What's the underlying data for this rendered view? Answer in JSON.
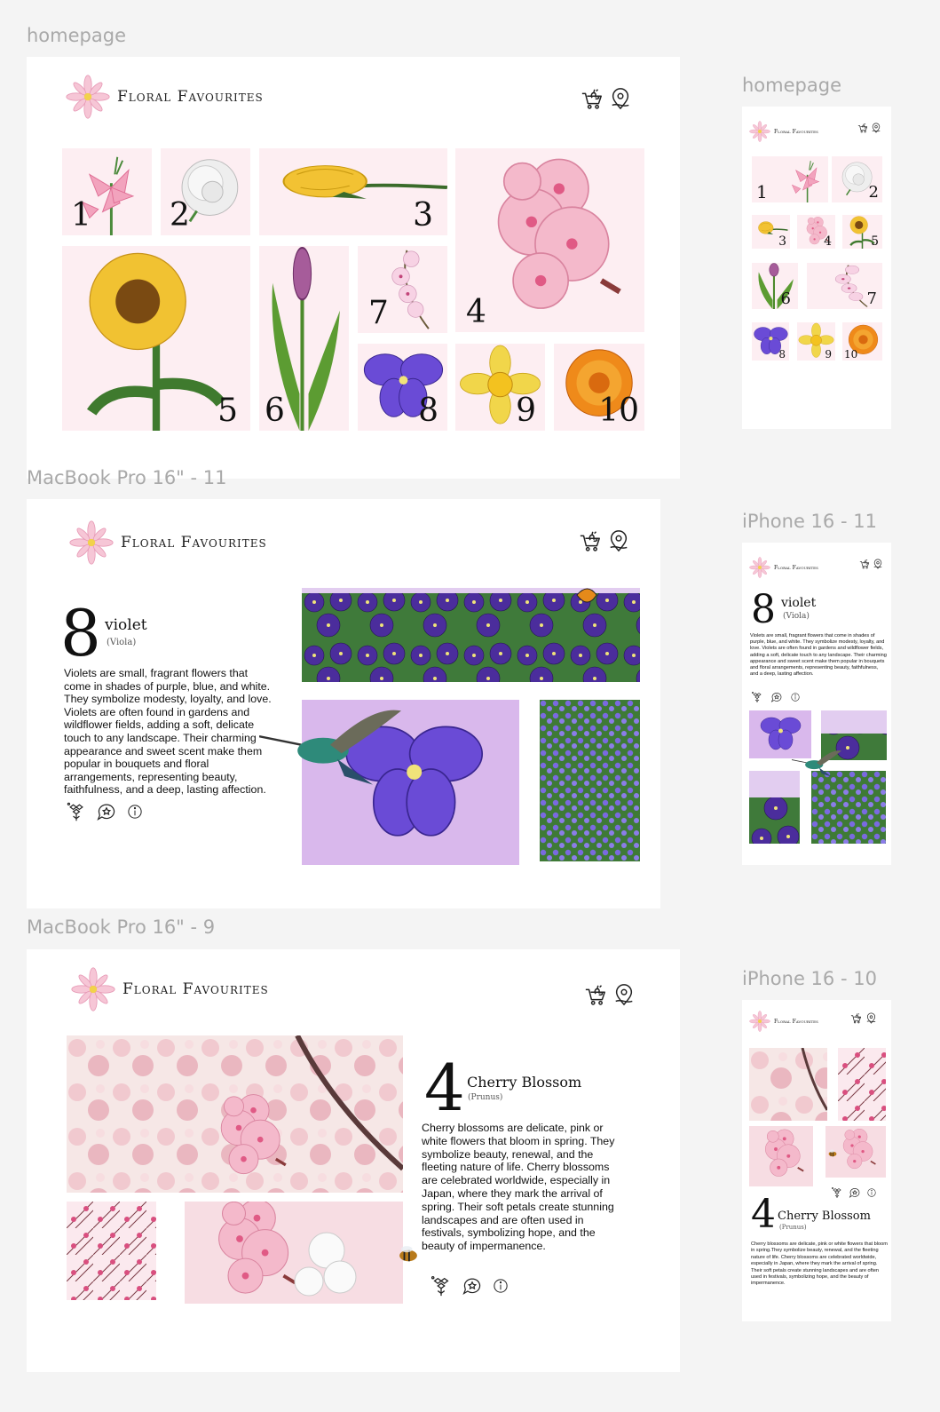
{
  "brand": {
    "name": "Floral Favourites"
  },
  "frames": {
    "homepage_desktop": {
      "label": "homepage"
    },
    "homepage_mobile": {
      "label": "homepage"
    },
    "macbook_11": {
      "label": "MacBook Pro 16\" - 11"
    },
    "iphone_11": {
      "label": "iPhone 16 - 11"
    },
    "macbook_9": {
      "label": "MacBook Pro 16\" - 9"
    },
    "iphone_10": {
      "label": "iPhone 16 - 10"
    }
  },
  "header_icons": [
    "cart-flower-icon",
    "location-pin-icon"
  ],
  "grid_tiles": [
    {
      "number": "1",
      "flower": "lily"
    },
    {
      "number": "2",
      "flower": "peony"
    },
    {
      "number": "3",
      "flower": "rose"
    },
    {
      "number": "4",
      "flower": "cherry blossom"
    },
    {
      "number": "5",
      "flower": "sunflower"
    },
    {
      "number": "6",
      "flower": "tulip"
    },
    {
      "number": "7",
      "flower": "orchid"
    },
    {
      "number": "8",
      "flower": "violet"
    },
    {
      "number": "9",
      "flower": "daffodil"
    },
    {
      "number": "10",
      "flower": "marigold"
    }
  ],
  "violet": {
    "number": "8",
    "name": "violet",
    "latin": "(Viola)",
    "description": "Violets are small, fragrant flowers that come in shades of purple, blue, and white. They symbolize modesty, loyalty, and love. Violets are often found in gardens and wildflower fields, adding a soft, delicate touch to any landscape. Their charming appearance and sweet scent make them popular in bouquets and floral arrangements, representing beauty, faithfulness, and a deep, lasting affection."
  },
  "cherry": {
    "number": "4",
    "name": "Cherry Blossom",
    "latin": "(Prunus)",
    "description": "Cherry blossoms are delicate, pink or white flowers that bloom in spring. They symbolize beauty, renewal, and the fleeting nature of life. Cherry blossoms are celebrated worldwide, especially in Japan, where they mark the arrival of spring. Their soft petals create stunning landscapes and are often used in festivals, symbolizing hope, and the beauty of impermanence.",
    "description_mobile": "Cherry blossoms are delicate, pink or white flowers that bloom in spring.They symbolize beauty, renewal, and the fleeting nature of life. Cherry blossoms are celebrated worldwide, especially in Japan, where they mark the arrival of spring. Their soft petals create stunning landscapes and are often used in festivals, symbolizing hope, and the beauty of impermanence."
  },
  "action_icons": [
    "bouquet-icon",
    "chat-flower-icon",
    "info-icon"
  ],
  "colors": {
    "tile_pink": "#fdeef2",
    "lavender": "#d9b8ec",
    "canvas": "#f4f4f4"
  }
}
